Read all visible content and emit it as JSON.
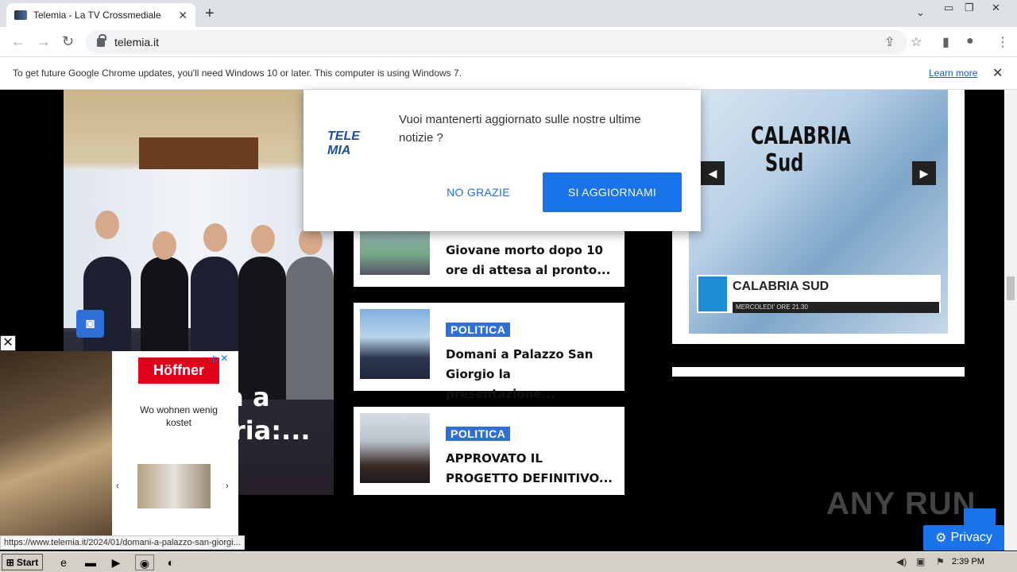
{
  "browser": {
    "tab_title": "Telemia - La TV Crossmediale",
    "new_tab": "+",
    "url": "telemia.it",
    "infobar_message": "To get future Google Chrome updates, you'll need Windows 10 or later. This computer is using Windows 7.",
    "infobar_link": "Learn more"
  },
  "popup": {
    "logo_text": "TELE MIA",
    "message": "Vuoi mantenerti aggiornato sulle nostre ultime notizie ?",
    "decline_label": "NO GRAZIE",
    "accept_label": "SI AGGIORNAMI"
  },
  "hero": {
    "overlay_line1": "ta a",
    "overlay_line2": "bria:..."
  },
  "articles": [
    {
      "category": "",
      "headline": "Giovane morto dopo 10 ore di attesa al pronto..."
    },
    {
      "category": "POLITICA",
      "headline": "Domani a Palazzo San Giorgio la presentazione..."
    },
    {
      "category": "POLITICA",
      "headline": "APPROVATO IL PROGETTO DEFINITIVO..."
    }
  ],
  "sidebar_video": {
    "title_line1": "CALABRIA",
    "title_line2": "Sud",
    "lower_title": "CALABRIA SUD",
    "lower_sub": "MERCOLEDI' ORE 21.30"
  },
  "ad": {
    "brand": "Höffner",
    "copy": "Wo wohnen wenig kostet",
    "close": "✕"
  },
  "status_url": "https://www.telemia.it/2024/01/domani-a-palazzo-san-giorgi...",
  "watermark": "ANY RUN",
  "privacy_label": "Privacy",
  "taskbar": {
    "start_label": "Start",
    "clock": "2:39 PM"
  },
  "colors": {
    "accent": "#1a73e8",
    "tag_blue": "#2f6fd8",
    "ad_red": "#e2001a"
  }
}
